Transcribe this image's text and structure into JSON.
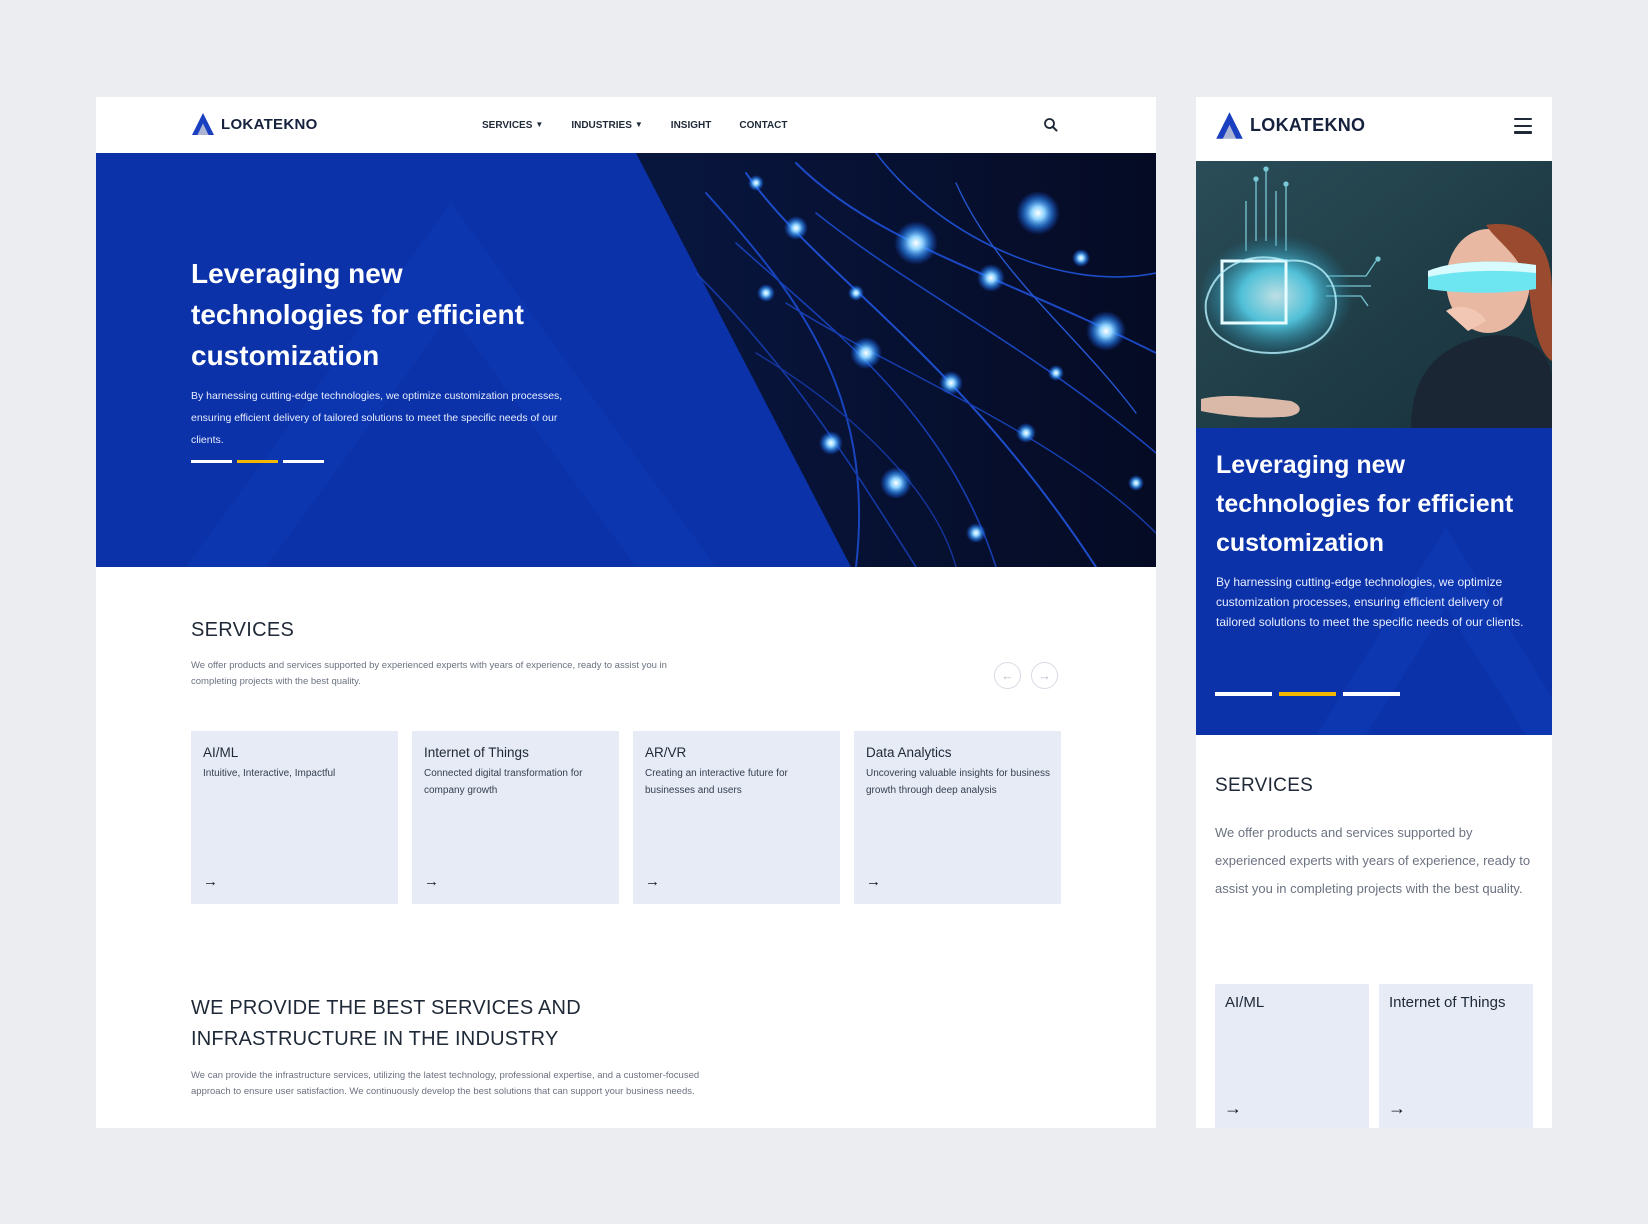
{
  "brand": {
    "name": "LOKATEKNO",
    "logo_color": "#1b3fc1"
  },
  "desktop": {
    "nav": {
      "items": [
        {
          "label": "SERVICES",
          "dropdown": true
        },
        {
          "label": "INDUSTRIES",
          "dropdown": true
        },
        {
          "label": "INSIGHT",
          "dropdown": false
        },
        {
          "label": "CONTACT",
          "dropdown": false
        }
      ],
      "search_icon": "search-icon"
    },
    "hero": {
      "title": "Leveraging new technologies for efficient customization",
      "description": "By harnessing cutting-edge technologies, we optimize customization processes, ensuring efficient delivery of tailored solutions to meet the specific needs of our clients.",
      "slides": 3,
      "active_slide": 2
    },
    "services": {
      "title": "SERVICES",
      "description": "We offer products and services supported by experienced experts with years of experience, ready to assist you in completing projects with the best quality.",
      "prev_icon": "arrow-left-icon",
      "next_icon": "arrow-right-icon",
      "cards": [
        {
          "title": "AI/ML",
          "subtitle": "Intuitive, Interactive, Impactful"
        },
        {
          "title": "Internet of Things",
          "subtitle": "Connected digital transformation for company growth"
        },
        {
          "title": "AR/VR",
          "subtitle": "Creating an interactive future for businesses and users"
        },
        {
          "title": "Data Analytics",
          "subtitle": "Uncovering valuable insights for business growth through deep analysis"
        }
      ]
    },
    "best": {
      "title": "WE PROVIDE THE BEST SERVICES AND INFRASTRUCTURE IN THE INDUSTRY",
      "description": "We can provide the infrastructure services, utilizing the latest technology, professional expertise, and a customer-focused approach to ensure user satisfaction. We continuously develop the best solutions that can support your business needs."
    }
  },
  "mobile": {
    "menu_icon": "hamburger-menu-icon",
    "hero": {
      "title": "Leveraging new technologies for efficient customization",
      "description": "By harnessing cutting-edge technologies, we optimize customization processes, ensuring efficient delivery of tailored solutions to meet the specific needs of our clients.",
      "slides": 3,
      "active_slide": 2
    },
    "services": {
      "title": "SERVICES",
      "description": "We offer products and services supported by experienced experts with years of experience, ready to assist you in completing projects with the best quality.",
      "cards": [
        {
          "title": "AI/ML"
        },
        {
          "title": "Internet of Things"
        }
      ]
    }
  },
  "colors": {
    "page_bg": "#ebedf1",
    "primary_blue": "#0b32a8",
    "accent_yellow": "#f5b800",
    "card_bg": "#e6ebf6",
    "text_dark": "#1f2937",
    "text_muted": "#6b7280"
  }
}
